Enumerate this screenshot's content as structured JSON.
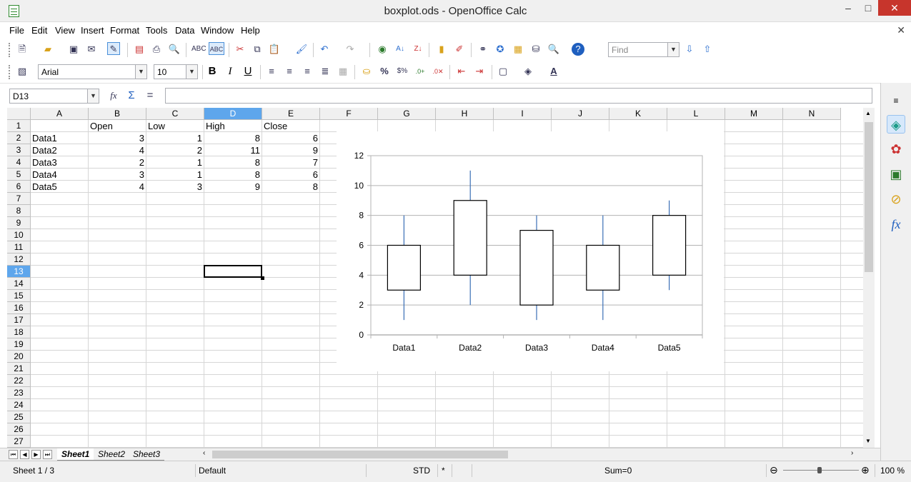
{
  "window": {
    "title": "boxplot.ods - OpenOffice Calc",
    "minimize": "–",
    "restore": "□",
    "close": "✕"
  },
  "menu": [
    {
      "label": "File"
    },
    {
      "label": "Edit"
    },
    {
      "label": "View"
    },
    {
      "label": "Insert"
    },
    {
      "label": "Format"
    },
    {
      "label": "Tools"
    },
    {
      "label": "Data"
    },
    {
      "label": "Window"
    },
    {
      "label": "Help"
    }
  ],
  "toolbar": {
    "find_placeholder": "Find",
    "font_name": "Arial",
    "font_size": "10",
    "bold": "B",
    "italic": "I",
    "underline": "U",
    "percent": "%"
  },
  "formula_bar": {
    "name_box": "D13",
    "formula": ""
  },
  "columns": [
    "A",
    "B",
    "C",
    "D",
    "E",
    "F",
    "G",
    "H",
    "I",
    "J",
    "K",
    "L",
    "M",
    "N"
  ],
  "rows": [
    "1",
    "2",
    "3",
    "4",
    "5",
    "6",
    "7",
    "8",
    "9",
    "10",
    "11",
    "12",
    "13",
    "14",
    "15",
    "16",
    "17",
    "18",
    "19",
    "20",
    "21",
    "22",
    "23",
    "24",
    "25",
    "26",
    "27"
  ],
  "selected": {
    "column": "D",
    "row": "13"
  },
  "cells": {
    "headers": [
      "Open",
      "Low",
      "High",
      "Close"
    ],
    "data": [
      [
        "Data1",
        "3",
        "1",
        "8",
        "6"
      ],
      [
        "Data2",
        "4",
        "2",
        "11",
        "9"
      ],
      [
        "Data3",
        "2",
        "1",
        "8",
        "7"
      ],
      [
        "Data4",
        "3",
        "1",
        "8",
        "6"
      ],
      [
        "Data5",
        "4",
        "3",
        "9",
        "8"
      ]
    ]
  },
  "chart_data": {
    "type": "candlestick",
    "categories": [
      "Data1",
      "Data2",
      "Data3",
      "Data4",
      "Data5"
    ],
    "open": [
      3,
      4,
      2,
      3,
      4
    ],
    "low": [
      1,
      2,
      1,
      1,
      3
    ],
    "high": [
      8,
      11,
      8,
      8,
      9
    ],
    "close": [
      6,
      9,
      7,
      6,
      8
    ],
    "ylim": [
      0,
      12
    ],
    "yticks": [
      "0",
      "2",
      "4",
      "6",
      "8",
      "10",
      "12"
    ],
    "grid": true,
    "colors": {
      "wick": "#3b6fb6",
      "box_stroke": "#000000",
      "box_fill": "#ffffff",
      "grid": "#b3b3b3"
    }
  },
  "sheets": [
    {
      "label": "Sheet1"
    },
    {
      "label": "Sheet2"
    },
    {
      "label": "Sheet3"
    }
  ],
  "status": {
    "sheet": "Sheet 1 / 3",
    "style": "Default",
    "mode": "STD",
    "modified": "*",
    "sum": "Sum=0",
    "zoom": "100 %",
    "zoom_minus": "⊖",
    "zoom_plus": "⊕"
  }
}
